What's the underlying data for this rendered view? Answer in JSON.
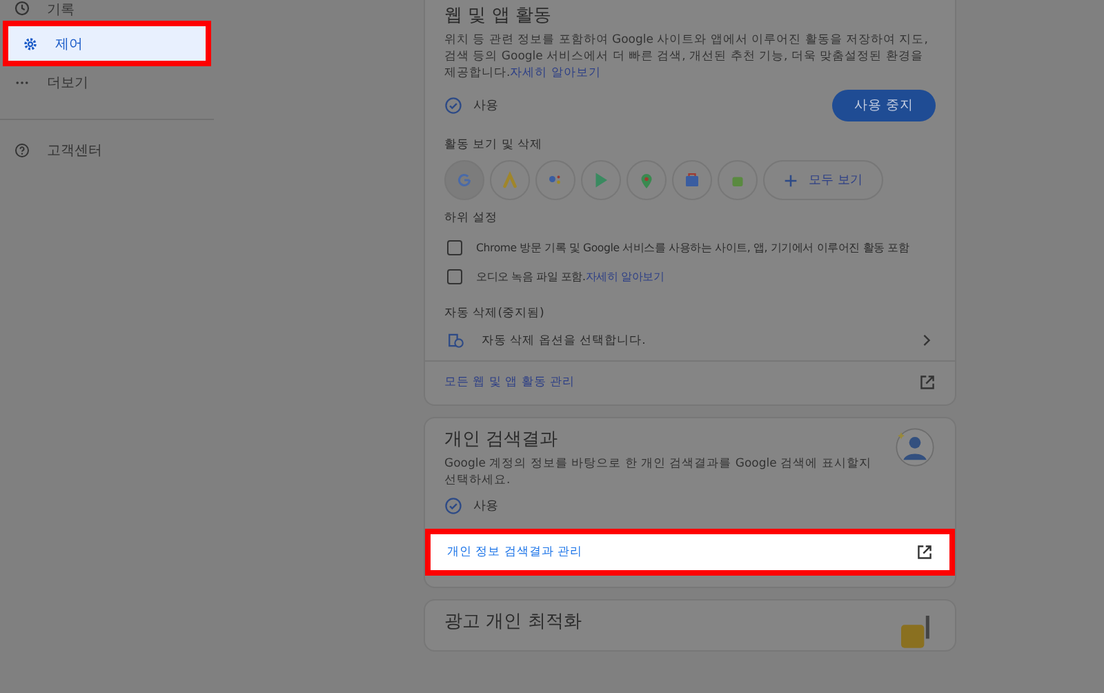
{
  "sidebar": {
    "items": [
      {
        "label": "기록",
        "selected": false,
        "highlighted": false
      },
      {
        "label": "제어",
        "selected": true,
        "highlighted": true
      },
      {
        "label": "더보기",
        "selected": false,
        "highlighted": false
      }
    ],
    "footer_items": [
      {
        "label": "고객센터"
      }
    ]
  },
  "cards": [
    {
      "title": "웹 및 앱 활동",
      "description": "위치 등 관련 정보를 포함하여 Google 사이트와 앱에서 이루어진 활동을 저장하여 지도, 검색 등의 Google 서비스에서 더 빠른 검색, 개선된 추천 기능, 더욱 맞춤설정된 환경을 제공합니다.",
      "description_link": "자세히 알아보기",
      "status": "사용",
      "button": "사용 중지",
      "activity": {
        "heading": "활동 보기 및 삭제",
        "apps": [
          {
            "kind": "google"
          },
          {
            "kind": "ads"
          },
          {
            "kind": "assistant"
          },
          {
            "kind": "play"
          },
          {
            "kind": "maps"
          },
          {
            "kind": "shopping"
          },
          {
            "kind": "android"
          }
        ],
        "more": "모두 보기"
      },
      "subsettings": {
        "heading": "하위 설정",
        "items": [
          {
            "text": "Chrome 방문 기록 및 Google 서비스를 사용하는 사이트, 앱, 기기에서 이루어진 활동 포함",
            "checked": false
          },
          {
            "text": "오디오 녹음 파일 포함.",
            "link": "자세히 알아보기",
            "checked": false
          }
        ]
      },
      "auto_delete": {
        "heading": "자동 삭제(중지됨)",
        "text": "자동 삭제 옵션을 선택합니다."
      },
      "link_row": {
        "label": "모든 웹 및 앱 활동 관리",
        "highlighted": false
      }
    },
    {
      "title": "개인 검색결과",
      "description": "Google 계정의 정보를 바탕으로 한 개인 검색결과를 Google 검색에 표시할지 선택하세요.",
      "status": "사용",
      "link_row": {
        "label": "개인 정보 검색결과 관리",
        "highlighted": true
      }
    },
    {
      "title": "광고 개인 최적화"
    }
  ]
}
